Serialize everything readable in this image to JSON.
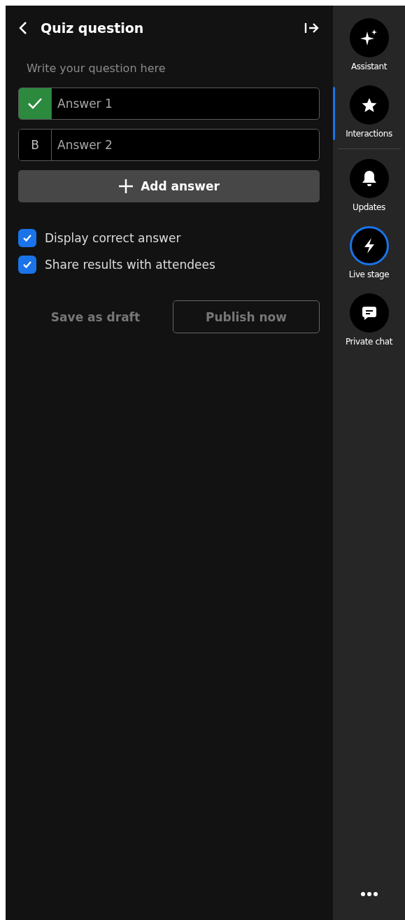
{
  "header": {
    "title": "Quiz question"
  },
  "question": {
    "placeholder": "Write your question here"
  },
  "answers": [
    {
      "placeholder": "Answer 1",
      "correct": true
    },
    {
      "letter": "B",
      "placeholder": "Answer 2",
      "correct": false
    }
  ],
  "add_answer": "Add answer",
  "options": [
    {
      "label": "Display correct answer",
      "checked": true
    },
    {
      "label": "Share results with attendees",
      "checked": true
    }
  ],
  "buttons": {
    "draft": "Save as draft",
    "publish": "Publish now"
  },
  "rail": [
    {
      "kind": "sparkles",
      "label": "Assistant",
      "selected": false,
      "ring": false
    },
    {
      "kind": "star",
      "label": "Interactions",
      "selected": true,
      "ring": false
    },
    {
      "kind": "bell",
      "label": "Updates",
      "selected": false,
      "ring": false
    },
    {
      "kind": "bolt",
      "label": "Live stage",
      "selected": false,
      "ring": true
    },
    {
      "kind": "chat",
      "label": "Private chat",
      "selected": false,
      "ring": false
    }
  ]
}
